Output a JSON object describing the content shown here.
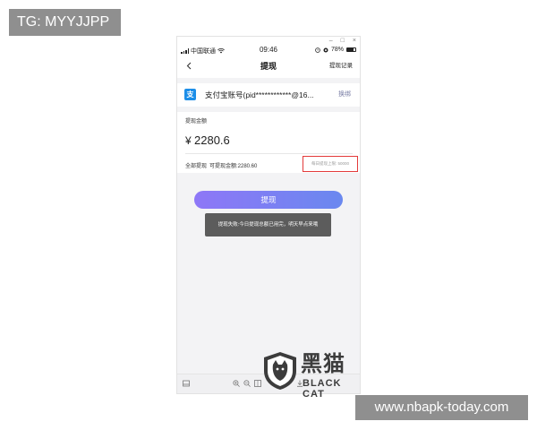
{
  "overlay": {
    "tg_label": "TG: MYYJJPP",
    "site_url": "www.nbapk-today.com"
  },
  "status_bar": {
    "carrier": "中国联通",
    "time": "09:46",
    "battery": "78%"
  },
  "window_controls": {
    "minimize": "–",
    "maximize": "□",
    "close": "×"
  },
  "nav": {
    "back_icon": "chevron-left-icon",
    "title": "提现",
    "record": "提现记录"
  },
  "account": {
    "icon_glyph": "支",
    "text": "支付宝账号(pid************@16...",
    "switch": "换绑"
  },
  "amount": {
    "label": "提现金额",
    "currency": "¥",
    "value": "2280.6",
    "withdraw_all": "全部提现",
    "available": "可提现金额:2280.60",
    "daily_limit": "每日提现上限: 50000"
  },
  "action": {
    "button": "提现"
  },
  "toast": {
    "message": "提现失败:今日提现总额已用完，明天早点来哦"
  },
  "watermark": {
    "chinese": "黑猫",
    "english": "BLACK CAT"
  },
  "colors": {
    "button_start": "#8e77f7",
    "button_end": "#6a88ef",
    "alipay_blue": "#1c8ee8",
    "highlight_red": "#e33a3a",
    "toast_bg": "#5c5c5c"
  }
}
